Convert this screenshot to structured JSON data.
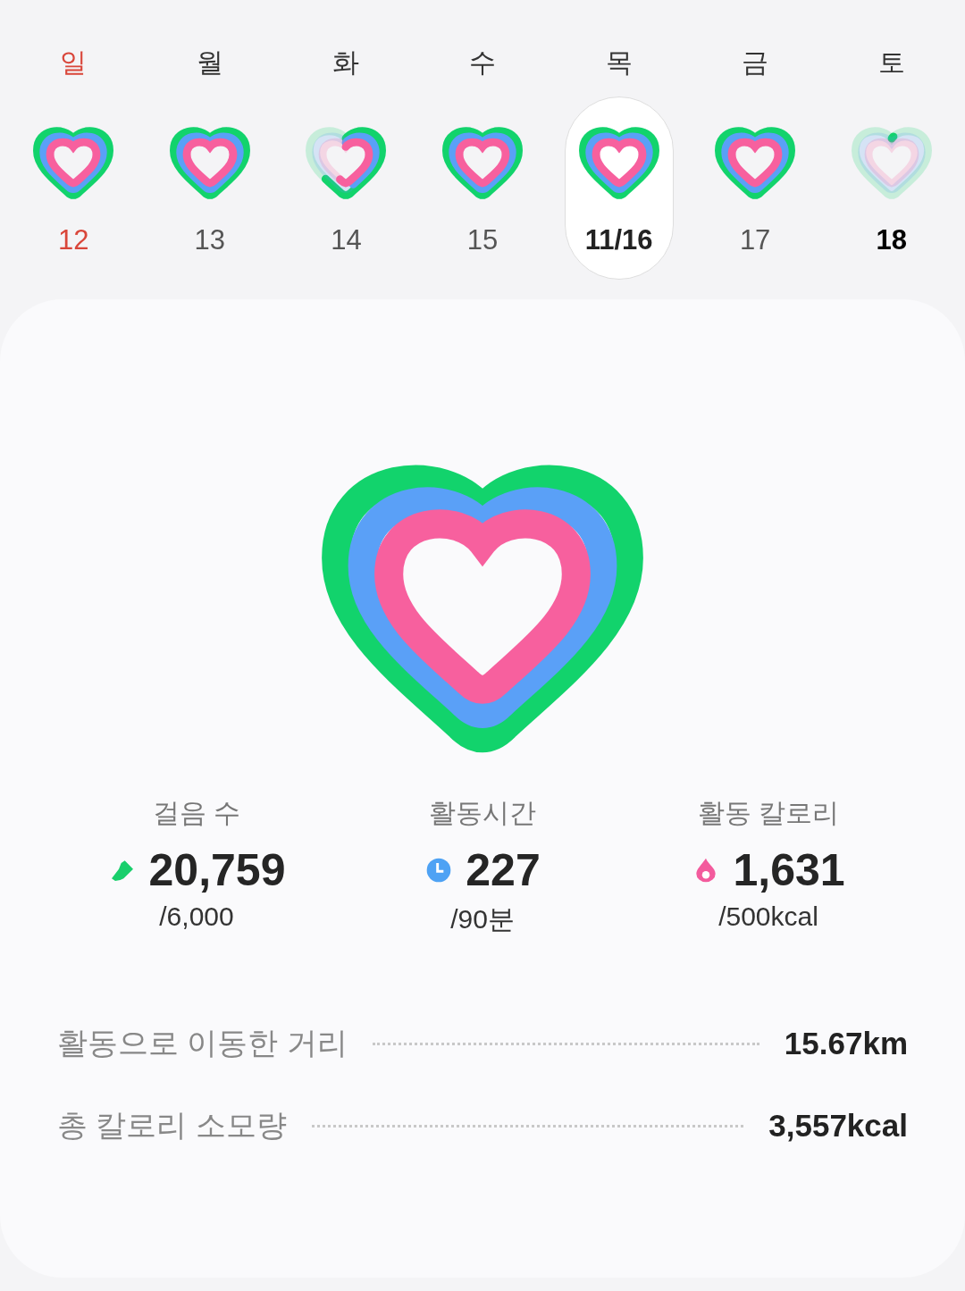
{
  "days": [
    {
      "weekday": "일",
      "date": "12",
      "holiday": true,
      "today": false,
      "selected": false,
      "kind": "complete"
    },
    {
      "weekday": "월",
      "date": "13",
      "holiday": false,
      "today": false,
      "selected": false,
      "kind": "complete"
    },
    {
      "weekday": "화",
      "date": "14",
      "holiday": false,
      "today": false,
      "selected": false,
      "kind": "partial"
    },
    {
      "weekday": "수",
      "date": "15",
      "holiday": false,
      "today": false,
      "selected": false,
      "kind": "complete"
    },
    {
      "weekday": "목",
      "date": "11/16",
      "holiday": false,
      "today": false,
      "selected": true,
      "kind": "complete"
    },
    {
      "weekday": "금",
      "date": "17",
      "holiday": false,
      "today": false,
      "selected": false,
      "kind": "complete"
    },
    {
      "weekday": "토",
      "date": "18",
      "holiday": false,
      "today": true,
      "selected": false,
      "kind": "empty"
    }
  ],
  "stats": [
    {
      "kind": "steps",
      "label": "걸음 수",
      "value": "20,759",
      "goal": "/6,000"
    },
    {
      "kind": "time",
      "label": "활동시간",
      "value": "227",
      "goal": "/90분"
    },
    {
      "kind": "calories",
      "label": "활동 칼로리",
      "value": "1,631",
      "goal": "/500kcal"
    }
  ],
  "summary": [
    {
      "label": "활동으로 이동한 거리",
      "value": "15.67km"
    },
    {
      "label": "총 칼로리 소모량",
      "value": "3,557kcal"
    }
  ]
}
